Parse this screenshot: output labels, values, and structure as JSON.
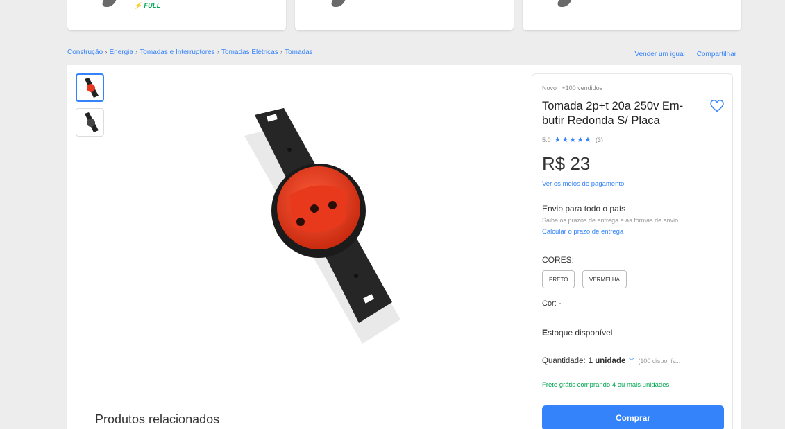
{
  "top_cards": {
    "badge_full": "FULL"
  },
  "breadcrumb": {
    "items": [
      "Construção",
      "Energia",
      "Tomadas e Interruptores",
      "Tomadas Elétricas",
      "Tomadas"
    ]
  },
  "actions": {
    "sell_similar": "Vender um igual",
    "share": "Compartilhar"
  },
  "gallery": {
    "thumbnails": [
      {
        "icon": "red-socket-thumbnail",
        "active": true
      },
      {
        "icon": "black-socket-thumbnail",
        "active": false
      }
    ]
  },
  "related": {
    "title": "Produtos relacionados"
  },
  "product": {
    "subtitle": "Novo  |  +100 vendidos",
    "title": "Tomada 2p+t 20a 250v Em-butir Redonda S/ Placa",
    "rating": "5.0",
    "stars": "★★★★★",
    "reviews": "(3)",
    "price": "R$ 23",
    "payment_link": "Ver os meios de pagamento",
    "shipping_title": "Envio para todo o país",
    "shipping_sub": "Saiba os prazos de entrega e as formas de envio.",
    "shipping_link": "Calcular o prazo de entrega",
    "colors_label": "CORES:",
    "colors": [
      "PRETO",
      "VERMELHA"
    ],
    "color_selected": "Cor: -",
    "stock_first": "E",
    "stock_rest": "stoque disponível",
    "quantity_label": "Quantidade:",
    "quantity_value": "1 unidade",
    "quantity_available": "(100 disponív...",
    "free_shipping": "Frete grátis comprando 4 ou mais unidades",
    "buy_label": "Comprar"
  },
  "colors": {
    "accent": "#3483fa",
    "green": "#00a650",
    "background": "#ededed"
  }
}
